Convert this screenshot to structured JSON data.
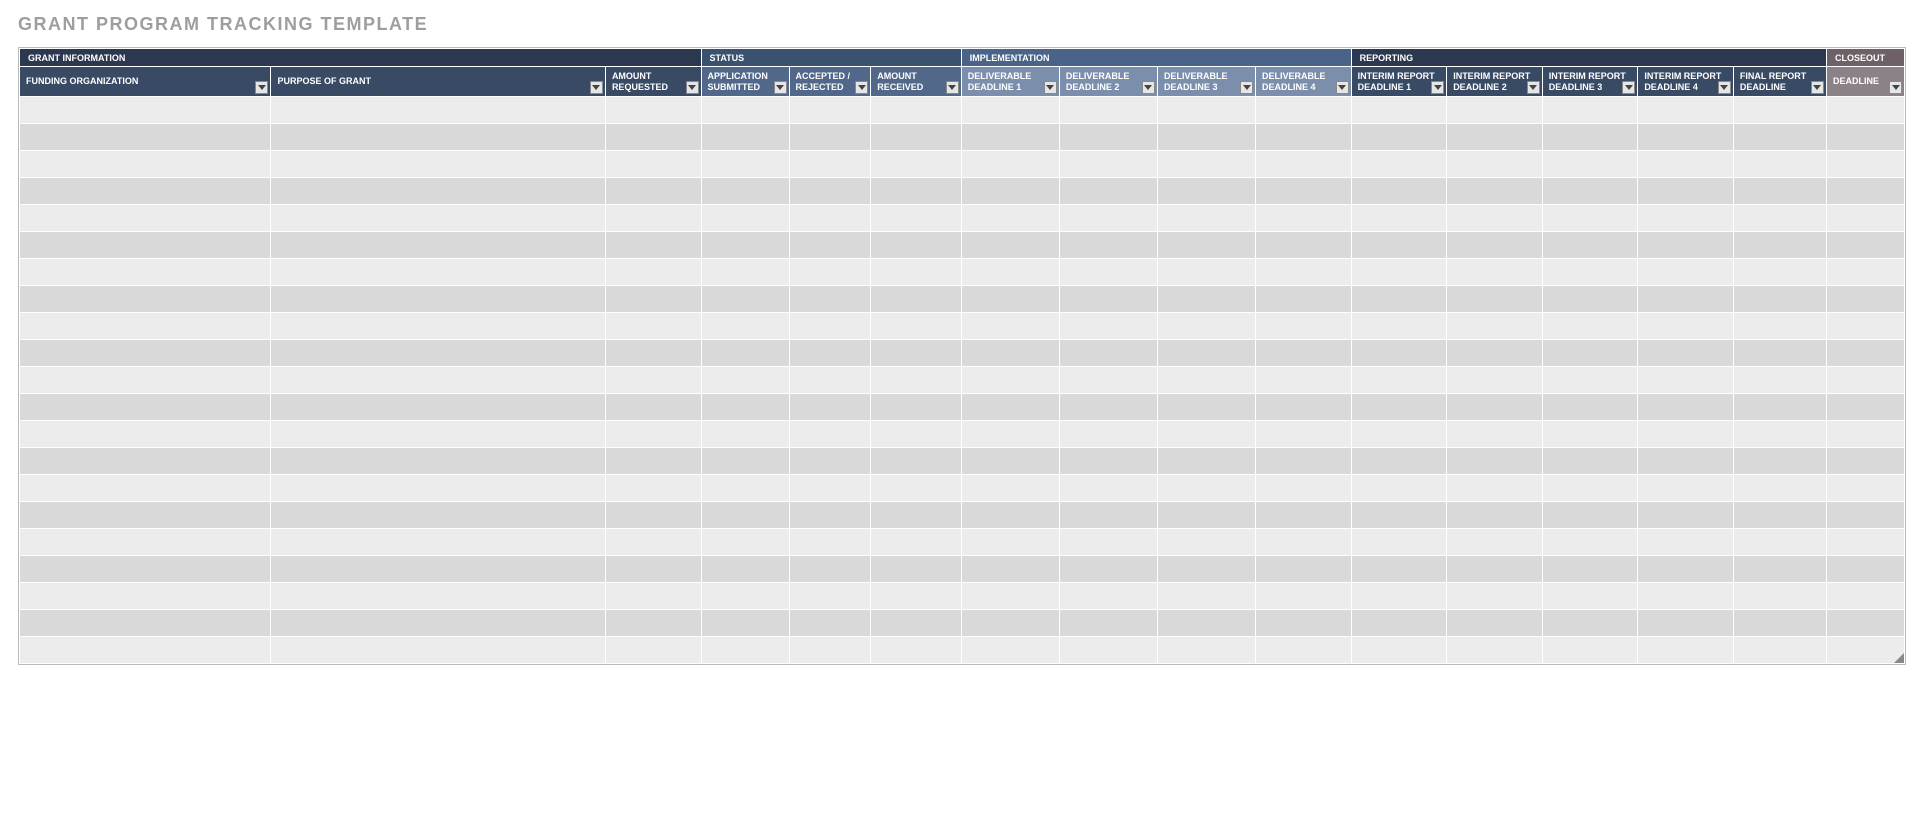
{
  "title": "GRANT PROGRAM TRACKING TEMPLATE",
  "sections": {
    "grant_info": "GRANT INFORMATION",
    "status": "STATUS",
    "implementation": "IMPLEMENTATION",
    "reporting": "REPORTING",
    "closeout": "CLOSEOUT"
  },
  "columns": {
    "funding_org": "FUNDING ORGANIZATION",
    "purpose": "PURPOSE OF GRANT",
    "amount_requested": "AMOUNT REQUESTED",
    "app_submitted": "APPLICATION SUBMITTED",
    "accepted_rejected": "ACCEPTED / REJECTED",
    "amount_received": "AMOUNT RECEIVED",
    "deliverable1": "DELIVERABLE DEADLINE 1",
    "deliverable2": "DELIVERABLE DEADLINE 2",
    "deliverable3": "DELIVERABLE DEADLINE 3",
    "deliverable4": "DELIVERABLE DEADLINE 4",
    "interim1": "INTERIM REPORT DEADLINE 1",
    "interim2": "INTERIM REPORT DEADLINE 2",
    "interim3": "INTERIM REPORT DEADLINE 3",
    "interim4": "INTERIM REPORT DEADLINE 4",
    "final_report": "FINAL REPORT DEADLINE",
    "closeout_deadline": "DEADLINE"
  },
  "row_count": 21,
  "col_widths": {
    "funding_org": 200,
    "purpose": 266,
    "amount_requested": 76,
    "app_submitted": 70,
    "accepted_rejected": 65,
    "amount_received": 72,
    "deliverable1": 78,
    "deliverable2": 78,
    "deliverable3": 78,
    "deliverable4": 76,
    "interim1": 76,
    "interim2": 76,
    "interim3": 76,
    "interim4": 76,
    "final_report": 74,
    "closeout_deadline": 62
  }
}
